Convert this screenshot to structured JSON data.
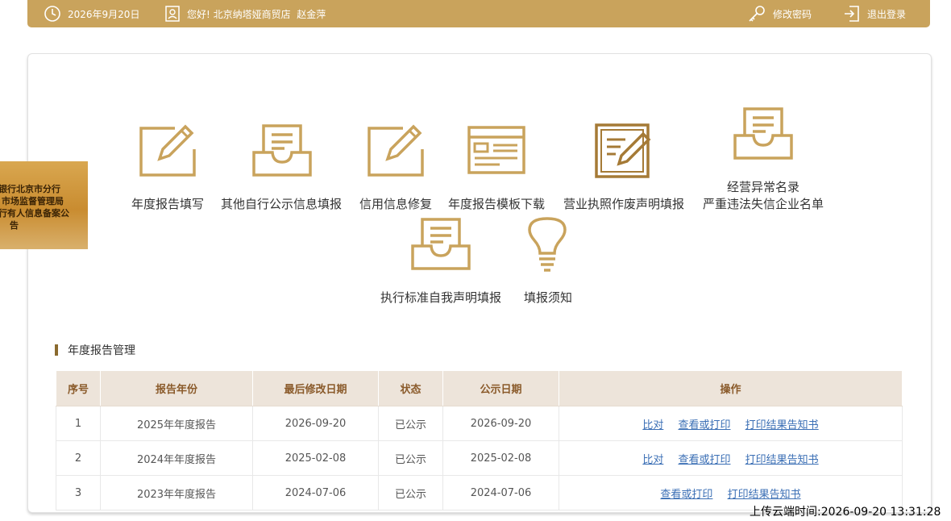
{
  "topbar": {
    "date": "2026年9月20日",
    "greeting": "您好! 北京纳塔娅商贸店  赵金萍",
    "change_password": "修改密码",
    "logout": "退出登录"
  },
  "functions": [
    {
      "label": "年度报告填写",
      "icon": "edit-form-icon"
    },
    {
      "label": "其他自行公示信息填报",
      "icon": "inbox-tray-icon"
    },
    {
      "label": "信用信息修复",
      "icon": "edit-form-icon"
    },
    {
      "label": "年度报告模板下载",
      "icon": "template-window-icon"
    },
    {
      "label": "营业执照作废声明填报",
      "icon": "document-edit-icon"
    },
    {
      "label_line1": "经营异常名录",
      "label_line2": "严重违法失信企业名单",
      "icon": "inbox-tray-icon"
    },
    {
      "label": "执行标准自我声明填报",
      "icon": "inbox-tray-icon"
    },
    {
      "label": "填报须知",
      "icon": "lightbulb-icon"
    }
  ],
  "section": {
    "title": "年度报告管理"
  },
  "table": {
    "headers": [
      "序号",
      "报告年份",
      "最后修改日期",
      "状态",
      "公示日期",
      "操作"
    ],
    "rows": [
      {
        "no": "1",
        "year": "2025年年度报告",
        "modified": "2026-09-20",
        "status": "已公示",
        "published": "2026-09-20",
        "actions": [
          "比对",
          "查看或打印",
          "打印结果告知书"
        ]
      },
      {
        "no": "2",
        "year": "2024年年度报告",
        "modified": "2025-02-08",
        "status": "已公示",
        "published": "2025-02-08",
        "actions": [
          "比对",
          "查看或打印",
          "打印结果告知书"
        ]
      },
      {
        "no": "3",
        "year": "2023年年度报告",
        "modified": "2024-07-06",
        "status": "已公示",
        "published": "2024-07-06",
        "actions": [
          "查看或打印",
          "打印结果告知书"
        ]
      }
    ]
  },
  "side_banner": {
    "line1": "银行北京市分行",
    "line2": "市场监督管理局",
    "line3": "行有人信息备案公",
    "line4": "告"
  },
  "upload_time": "上传云端时间:2026-09-20 13:31:28",
  "colors": {
    "gold": "#c9a35c",
    "icon_gold": "#c9a35c",
    "dark_gold": "#a57a36",
    "link": "#3b6fb5"
  }
}
